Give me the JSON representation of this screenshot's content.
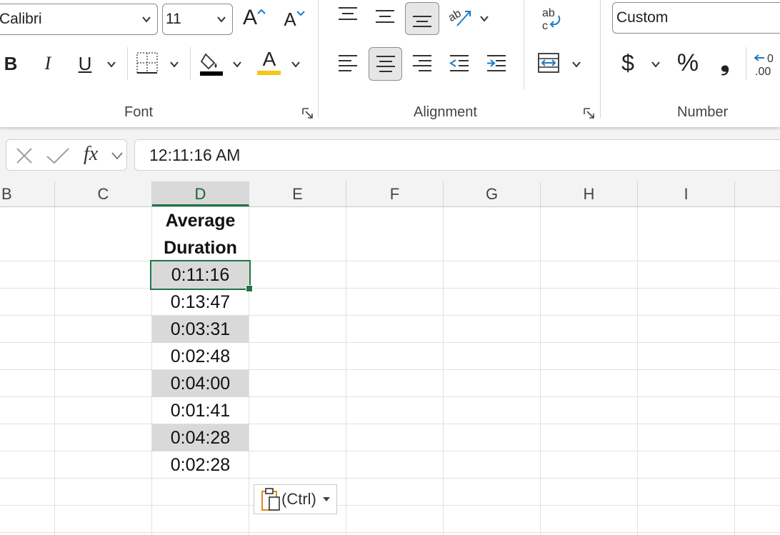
{
  "ribbon": {
    "font": {
      "label": "Font",
      "font_name": "Calibri",
      "font_size": "11",
      "increase_font_glyph": "A",
      "decrease_font_glyph": "A",
      "bold_glyph": "B",
      "italic_glyph": "I",
      "underline_glyph": "U",
      "font_color_glyph": "A",
      "fill_color": "#000000",
      "font_color": "#f2c811"
    },
    "alignment": {
      "label": "Alignment",
      "wrap_text_glyph": "ab"
    },
    "number": {
      "label": "Number",
      "format_value": "Custom",
      "currency_glyph": "$",
      "percent_glyph": "%",
      "comma_glyph": "❟",
      "increase_decimal_glyph": ".00"
    }
  },
  "formula_bar": {
    "fx_label": "fx",
    "value": "12:11:16 AM"
  },
  "columns": [
    "B",
    "C",
    "D",
    "E",
    "F",
    "G",
    "H",
    "I"
  ],
  "active_column": "D",
  "table": {
    "header_line1": "Average",
    "header_line2": "Duration",
    "rows": [
      "0:11:16",
      "0:13:47",
      "0:03:31",
      "0:02:48",
      "0:04:00",
      "0:01:41",
      "0:04:28",
      "0:02:28"
    ]
  },
  "paste_options": {
    "label": "(Ctrl)"
  },
  "colors": {
    "accent_green": "#217346",
    "shade": "#d9d9d9",
    "link_blue": "#1e7bc4"
  }
}
